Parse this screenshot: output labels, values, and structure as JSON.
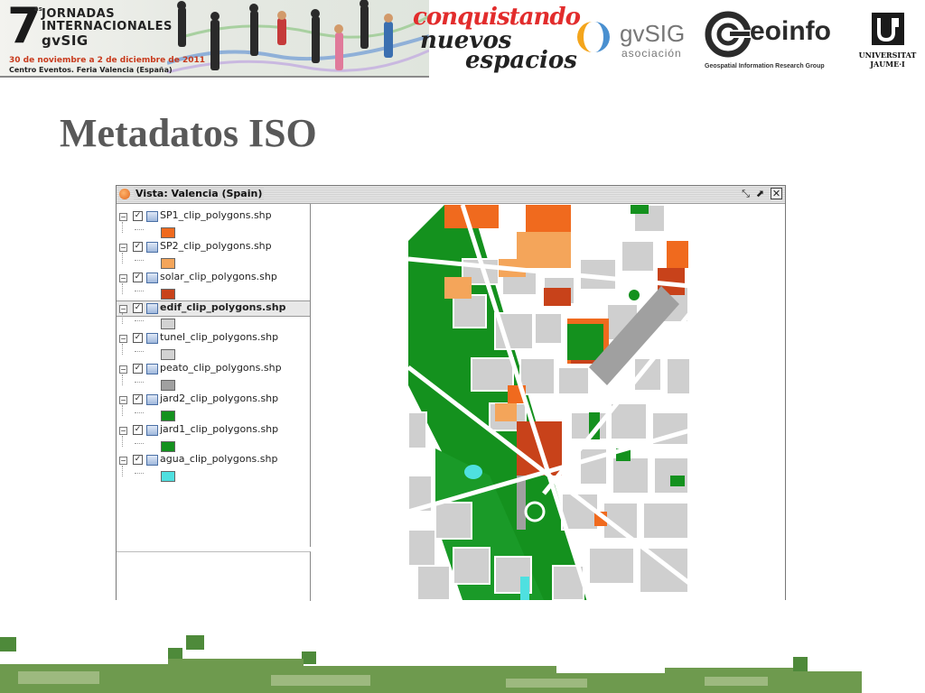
{
  "header": {
    "event_number": "7",
    "event_superscript": "as",
    "event_line1": "JORNADAS",
    "event_line2": "INTERNACIONALES",
    "event_line3": "gvSIG",
    "event_dates": "30 de noviembre a 2 de diciembre de 2011",
    "event_venue": "Centro Eventos. Feria Valencia (España)",
    "slogan_line1": "conquistando",
    "slogan_line2": "nuevos",
    "slogan_line3": "espacios",
    "gvsig_name": "gvSIG",
    "gvsig_sub": "asociación",
    "geoinfo_name": "eoinfo",
    "geoinfo_sub": "Geospatial Information Research Group",
    "uji_line1": "UNIVERSITAT",
    "uji_line2": "JAUME·I"
  },
  "slide": {
    "title": "Metadatos ISO"
  },
  "window": {
    "title": "Vista: Valencia (Spain)",
    "layers": [
      {
        "name": "SP1_clip_polygons.shp",
        "color": "#f06a1e",
        "selected": false
      },
      {
        "name": "SP2_clip_polygons.shp",
        "color": "#f4a55a",
        "selected": false
      },
      {
        "name": "solar_clip_polygons.shp",
        "color": "#c8421a",
        "selected": false
      },
      {
        "name": "edif_clip_polygons.shp",
        "color": "#d2d2d2",
        "selected": true
      },
      {
        "name": "tunel_clip_polygons.shp",
        "color": "#d2d2d2",
        "selected": false
      },
      {
        "name": "peato_clip_polygons.shp",
        "color": "#a0a0a0",
        "selected": false
      },
      {
        "name": "jard2_clip_polygons.shp",
        "color": "#14911e",
        "selected": false
      },
      {
        "name": "jard1_clip_polygons.shp",
        "color": "#14911e",
        "selected": false
      },
      {
        "name": "agua_clip_polygons.shp",
        "color": "#4fe0e0",
        "selected": false
      }
    ]
  },
  "colors": {
    "accent_green": "#4e8a3a",
    "title_gray": "#595959"
  }
}
